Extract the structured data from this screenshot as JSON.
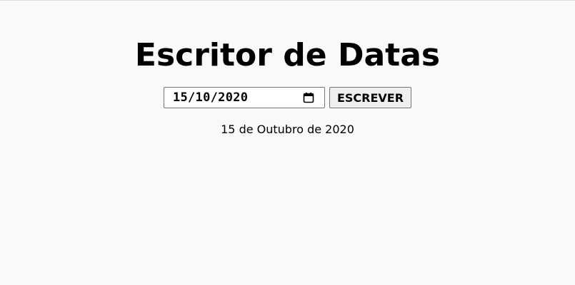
{
  "app": {
    "title": "Escritor de Datas"
  },
  "form": {
    "date_value": "15/10/2020",
    "button_label": "ESCREVER"
  },
  "output": {
    "text": "15 de Outubro de 2020"
  },
  "icons": {
    "calendar": "calendar-icon"
  }
}
